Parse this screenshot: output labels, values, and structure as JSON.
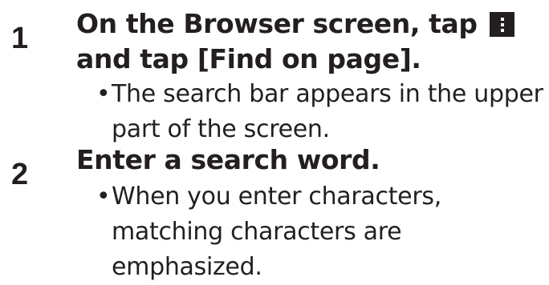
{
  "steps": [
    {
      "number": "1",
      "title_part1": "On the Browser screen, tap",
      "title_part2": "and tap [Find on page].",
      "icon": "menu-icon",
      "note": "The search bar appears in the upper part of the screen."
    },
    {
      "number": "2",
      "title": "Enter a search word.",
      "note": "When you enter characters, matching characters are emphasized."
    }
  ],
  "bullet": "•",
  "colors": {
    "text": "#231f20",
    "icon_bg": "#231f20",
    "icon_dots": "#ffffff"
  }
}
